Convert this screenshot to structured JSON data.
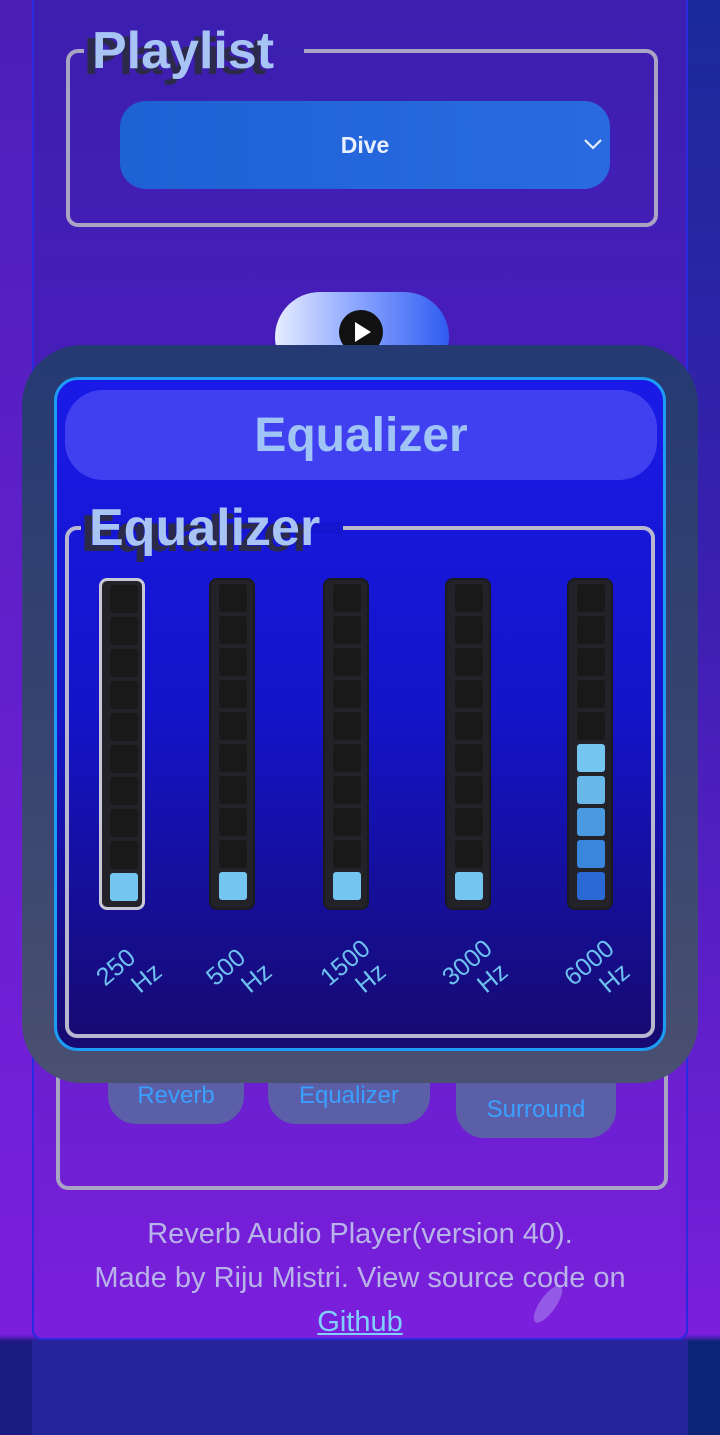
{
  "playlist": {
    "legend": "Playlist",
    "selected": "Dive"
  },
  "effects": {
    "buttons": [
      "Reverb",
      "Equalizer",
      "Surround"
    ]
  },
  "footer": {
    "line1": "Reverb Audio Player(version 40).",
    "line2": "Made by Riju Mistri. View source code on",
    "link": "Github"
  },
  "modal": {
    "title": "Equalizer",
    "legend": "Equalizer",
    "bands": [
      {
        "label_top": "250",
        "label_bottom": "Hz",
        "level": 1
      },
      {
        "label_top": "500",
        "label_bottom": "Hz",
        "level": 1
      },
      {
        "label_top": "1500",
        "label_bottom": "Hz",
        "level": 1
      },
      {
        "label_top": "3000",
        "label_bottom": "Hz",
        "level": 1
      },
      {
        "label_top": "6000",
        "label_bottom": "Hz",
        "level": 5
      }
    ],
    "max_level": 10
  },
  "colors": {
    "accent": "#2a6ae0",
    "eq_cell_on": "#74c5ef",
    "modal_border": "#1d9cf5"
  }
}
